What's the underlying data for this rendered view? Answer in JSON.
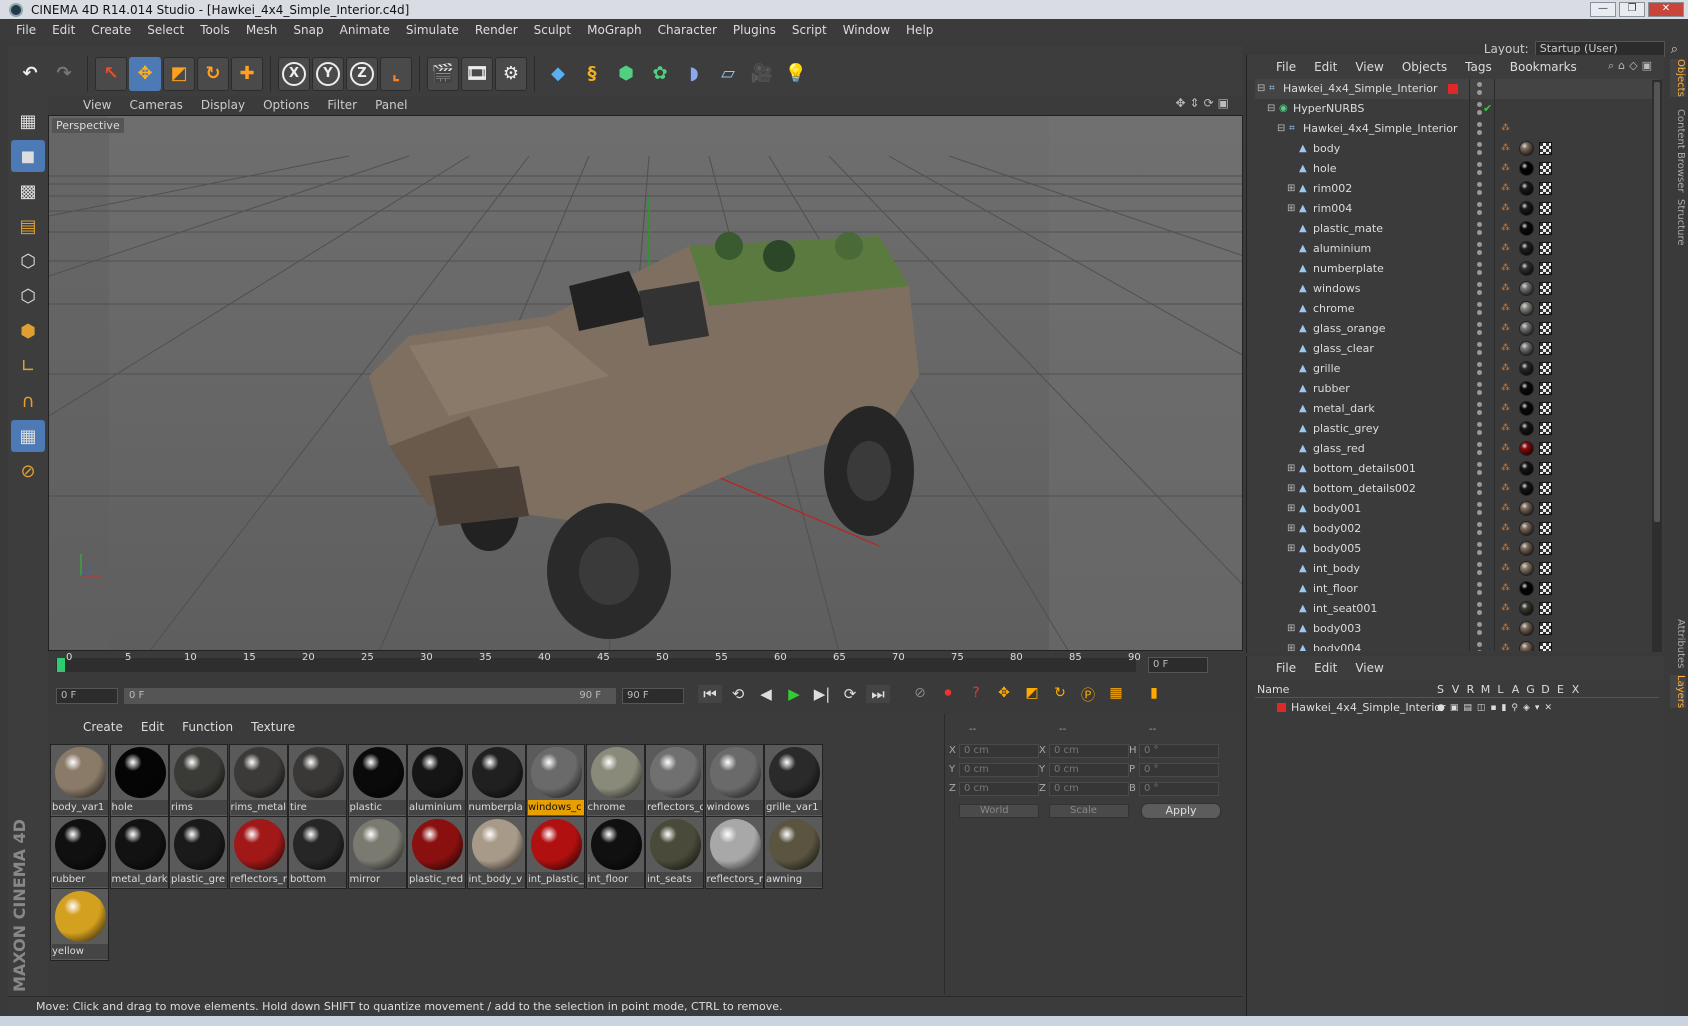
{
  "window": {
    "title": "CINEMA 4D R14.014 Studio - [Hawkei_4x4_Simple_Interior.c4d]"
  },
  "menubar": {
    "items": [
      "File",
      "Edit",
      "Create",
      "Select",
      "Tools",
      "Mesh",
      "Snap",
      "Animate",
      "Simulate",
      "Render",
      "Sculpt",
      "MoGraph",
      "Character",
      "Plugins",
      "Script",
      "Window",
      "Help"
    ],
    "layout_label": "Layout:",
    "layout_value": "Startup (User)"
  },
  "toolbar": {
    "axis_x": "X",
    "axis_y": "Y",
    "axis_z": "Z"
  },
  "viewport": {
    "menu": [
      "View",
      "Cameras",
      "Display",
      "Options",
      "Filter",
      "Panel"
    ],
    "label": "Perspective"
  },
  "timeline": {
    "ticks": [
      "0",
      "5",
      "10",
      "15",
      "20",
      "25",
      "30",
      "35",
      "40",
      "45",
      "50",
      "55",
      "60",
      "65",
      "70",
      "75",
      "80",
      "85",
      "90"
    ],
    "frame_field": "0 F"
  },
  "timecontrols": {
    "start": "0 F",
    "range_start": "0 F",
    "range_end": "90 F",
    "end": "90 F"
  },
  "materials": {
    "menu": [
      "Create",
      "Edit",
      "Function",
      "Texture"
    ],
    "items": [
      {
        "name": "body_var1",
        "color": "#8a7a68",
        "highlight": false
      },
      {
        "name": "hole",
        "color": "#050505",
        "highlight": false
      },
      {
        "name": "rims",
        "color": "#3a3a36",
        "highlight": false
      },
      {
        "name": "rims_metal",
        "color": "#3c3a38",
        "highlight": false
      },
      {
        "name": "tire",
        "color": "#3a3836",
        "highlight": false
      },
      {
        "name": "plastic",
        "color": "#0a0a0a",
        "highlight": false
      },
      {
        "name": "aluminium",
        "color": "#151515",
        "highlight": false
      },
      {
        "name": "numberpla",
        "color": "#202020",
        "highlight": false
      },
      {
        "name": "windows_c",
        "color": "#6a6a6a",
        "highlight": true
      },
      {
        "name": "chrome",
        "color": "#8a8a7a",
        "highlight": false
      },
      {
        "name": "reflectors_c",
        "color": "#707070",
        "highlight": false
      },
      {
        "name": "windows",
        "color": "#6a6a6a",
        "highlight": false
      },
      {
        "name": "grille_var1",
        "color": "#2a2a2a",
        "highlight": false
      },
      {
        "name": "rubber",
        "color": "#101010",
        "highlight": false
      },
      {
        "name": "metal_dark",
        "color": "#121212",
        "highlight": false
      },
      {
        "name": "plastic_gre",
        "color": "#1a1a1a",
        "highlight": false
      },
      {
        "name": "reflectors_r",
        "color": "#a01818",
        "highlight": false
      },
      {
        "name": "bottom",
        "color": "#262626",
        "highlight": false
      },
      {
        "name": "mirror",
        "color": "#7a7a70",
        "highlight": false
      },
      {
        "name": "plastic_red",
        "color": "#8a1010",
        "highlight": false
      },
      {
        "name": "int_body_v",
        "color": "#a89a88",
        "highlight": false
      },
      {
        "name": "int_plastic_",
        "color": "#b01010",
        "highlight": false
      },
      {
        "name": "int_floor",
        "color": "#101010",
        "highlight": false
      },
      {
        "name": "int_seats",
        "color": "#4a4a3a",
        "highlight": false
      },
      {
        "name": "reflectors_r",
        "color": "#a8a8a8",
        "highlight": false
      },
      {
        "name": "awning",
        "color": "#5a5440",
        "highlight": false
      },
      {
        "name": "yellow",
        "color": "#d4a020",
        "highlight": false
      }
    ]
  },
  "coordinates": {
    "header": [
      "--",
      "--",
      "--"
    ],
    "rows": [
      {
        "l1": "X",
        "v1": "0 cm",
        "l2": "X",
        "v2": "0 cm",
        "l3": "H",
        "v3": "0 °"
      },
      {
        "l1": "Y",
        "v1": "0 cm",
        "l2": "Y",
        "v2": "0 cm",
        "l3": "P",
        "v3": "0 °"
      },
      {
        "l1": "Z",
        "v1": "0 cm",
        "l2": "Z",
        "v2": "0 cm",
        "l3": "B",
        "v3": "0 °"
      }
    ],
    "space": "World",
    "mode": "Scale",
    "apply": "Apply"
  },
  "objects": {
    "menu": [
      "File",
      "Edit",
      "View",
      "Objects",
      "Tags",
      "Bookmarks"
    ],
    "items": [
      {
        "name": "Hawkei_4x4_Simple_Interior",
        "indent": 0,
        "expand": "⊟",
        "mat": ""
      },
      {
        "name": "HyperNURBS",
        "indent": 1,
        "expand": "⊟",
        "mat": ""
      },
      {
        "name": "Hawkei_4x4_Simple_Interior",
        "indent": 2,
        "expand": "⊟",
        "mat": ""
      },
      {
        "name": "body",
        "indent": 3,
        "expand": "",
        "mat": "#7a6a5a"
      },
      {
        "name": "hole",
        "indent": 3,
        "expand": "",
        "mat": "#050505"
      },
      {
        "name": "rim002",
        "indent": 3,
        "expand": "⊞",
        "mat": "#1a1a1a"
      },
      {
        "name": "rim004",
        "indent": 3,
        "expand": "⊞",
        "mat": "#1a1a1a"
      },
      {
        "name": "plastic_mate",
        "indent": 3,
        "expand": "",
        "mat": "#0a0a0a"
      },
      {
        "name": "aluminium",
        "indent": 3,
        "expand": "",
        "mat": "#202020"
      },
      {
        "name": "numberplate",
        "indent": 3,
        "expand": "",
        "mat": "#303030"
      },
      {
        "name": "windows",
        "indent": 3,
        "expand": "",
        "mat": "#777777"
      },
      {
        "name": "chrome",
        "indent": 3,
        "expand": "",
        "mat": "#888880"
      },
      {
        "name": "glass_orange",
        "indent": 3,
        "expand": "",
        "mat": "#777777"
      },
      {
        "name": "glass_clear",
        "indent": 3,
        "expand": "",
        "mat": "#777777"
      },
      {
        "name": "grille",
        "indent": 3,
        "expand": "",
        "mat": "#2a2a2a"
      },
      {
        "name": "rubber",
        "indent": 3,
        "expand": "",
        "mat": "#0a0a0a"
      },
      {
        "name": "metal_dark",
        "indent": 3,
        "expand": "",
        "mat": "#0a0a0a"
      },
      {
        "name": "plastic_grey",
        "indent": 3,
        "expand": "",
        "mat": "#151515"
      },
      {
        "name": "glass_red",
        "indent": 3,
        "expand": "",
        "mat": "#8a0a0a"
      },
      {
        "name": "bottom_details001",
        "indent": 3,
        "expand": "⊞",
        "mat": "#151515"
      },
      {
        "name": "bottom_details002",
        "indent": 3,
        "expand": "⊞",
        "mat": "#151515"
      },
      {
        "name": "body001",
        "indent": 3,
        "expand": "⊞",
        "mat": "#7a6a5a"
      },
      {
        "name": "body002",
        "indent": 3,
        "expand": "⊞",
        "mat": "#7a6a5a"
      },
      {
        "name": "body005",
        "indent": 3,
        "expand": "⊞",
        "mat": "#7a6a5a"
      },
      {
        "name": "int_body",
        "indent": 3,
        "expand": "",
        "mat": "#8a7a68"
      },
      {
        "name": "int_floor",
        "indent": 3,
        "expand": "",
        "mat": "#050505"
      },
      {
        "name": "int_seat001",
        "indent": 3,
        "expand": "",
        "mat": "#3a3a30"
      },
      {
        "name": "body003",
        "indent": 3,
        "expand": "⊞",
        "mat": "#7a6a5a"
      },
      {
        "name": "body004",
        "indent": 3,
        "expand": "⊞",
        "mat": "#7a6a5a"
      }
    ]
  },
  "layers": {
    "menu": [
      "File",
      "Edit",
      "View"
    ],
    "headers": [
      "Name",
      "S",
      "V",
      "R",
      "M",
      "L",
      "A",
      "G",
      "D",
      "E",
      "X"
    ],
    "item": "Hawkei_4x4_Simple_Interior"
  },
  "right_tabs": [
    "Objects",
    "Content Browser",
    "Structure",
    "Attributes",
    "Layers"
  ],
  "status": "Move: Click and drag to move elements. Hold down SHIFT to quantize movement / add to the selection in point mode, CTRL to remove.",
  "brand": "MAXON CINEMA 4D"
}
